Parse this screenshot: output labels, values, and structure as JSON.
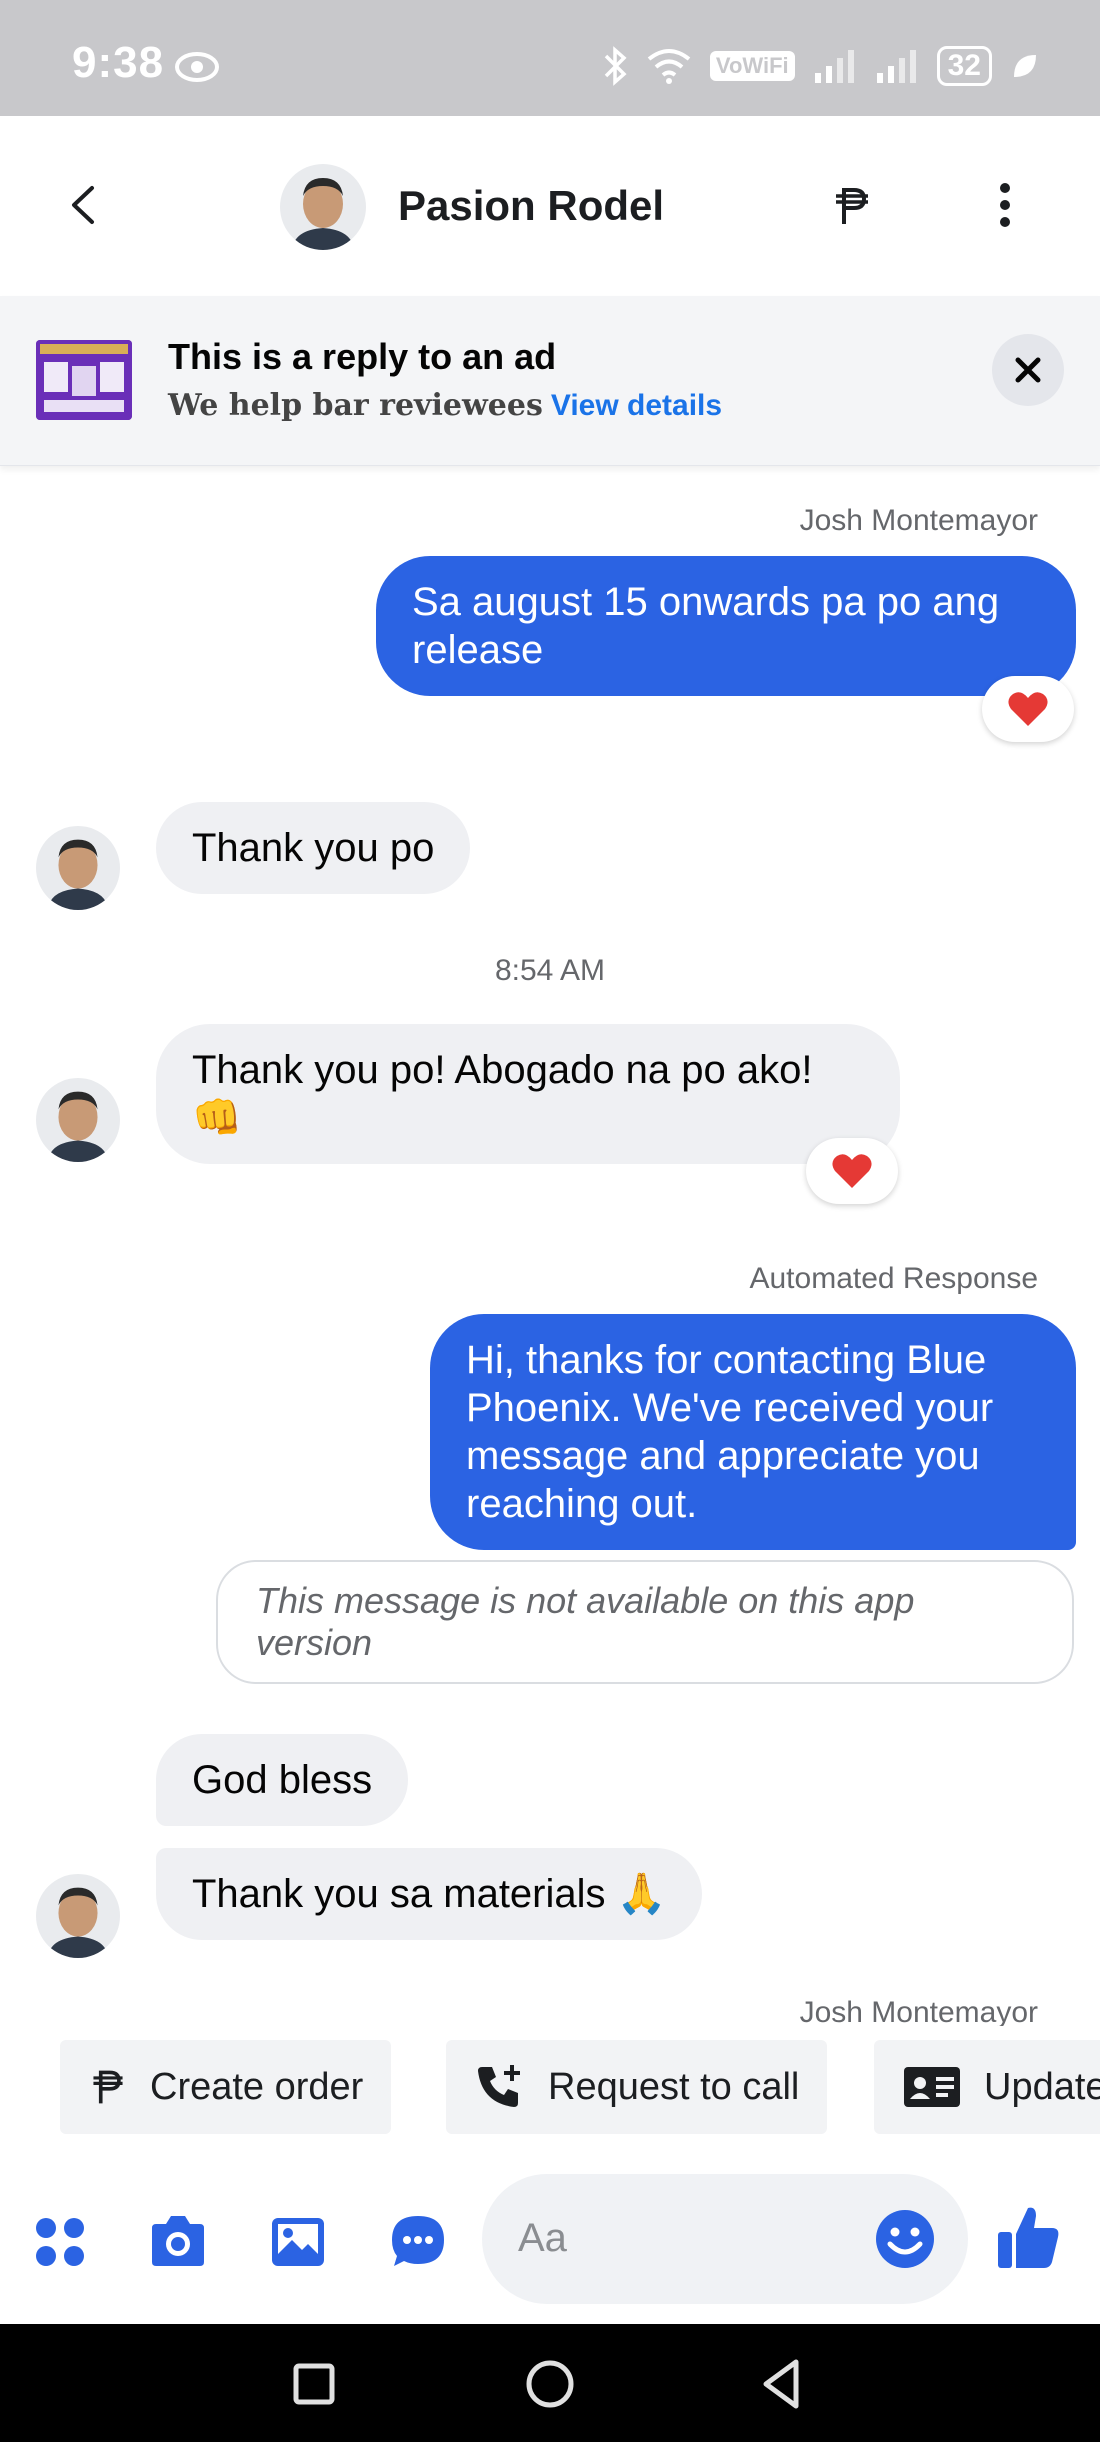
{
  "status_bar": {
    "time": "9:38",
    "vowifi": "VoWiFi",
    "vowifi_sub": "2",
    "battery": "32"
  },
  "header": {
    "contact_name": "Pasion Rodel"
  },
  "ad_banner": {
    "title": "This is a reply to an ad",
    "subtitle": "We help bar reviewees",
    "link": "View details"
  },
  "messages": {
    "sender_1": "Josh Montemayor",
    "msg_1": "Sa august 15 onwards pa po ang release",
    "msg_2": "Thank you po",
    "timestamp": "8:54 AM",
    "msg_3_line1": "Thank you po! Abogado na po ako!",
    "msg_3_emoji": "👊",
    "sender_2": "Automated Response",
    "msg_4": "Hi, thanks for contacting Blue Phoenix. We've received your message and appreciate you reaching out.",
    "notice": "This message is not available on this app version",
    "msg_5": "God bless",
    "msg_6": "Thank you sa materials",
    "msg_6_emoji": "🙏",
    "sender_3": "Josh Montemayor"
  },
  "quick_replies": {
    "create_order": "Create order",
    "request_call": "Request to call",
    "update": "Update"
  },
  "composer": {
    "placeholder": "Aa"
  },
  "colors": {
    "accent": "#2b63e3",
    "outgoing_bubble": "#2b63e3",
    "incoming_bubble": "#eff0f3",
    "heart": "#e53935"
  }
}
